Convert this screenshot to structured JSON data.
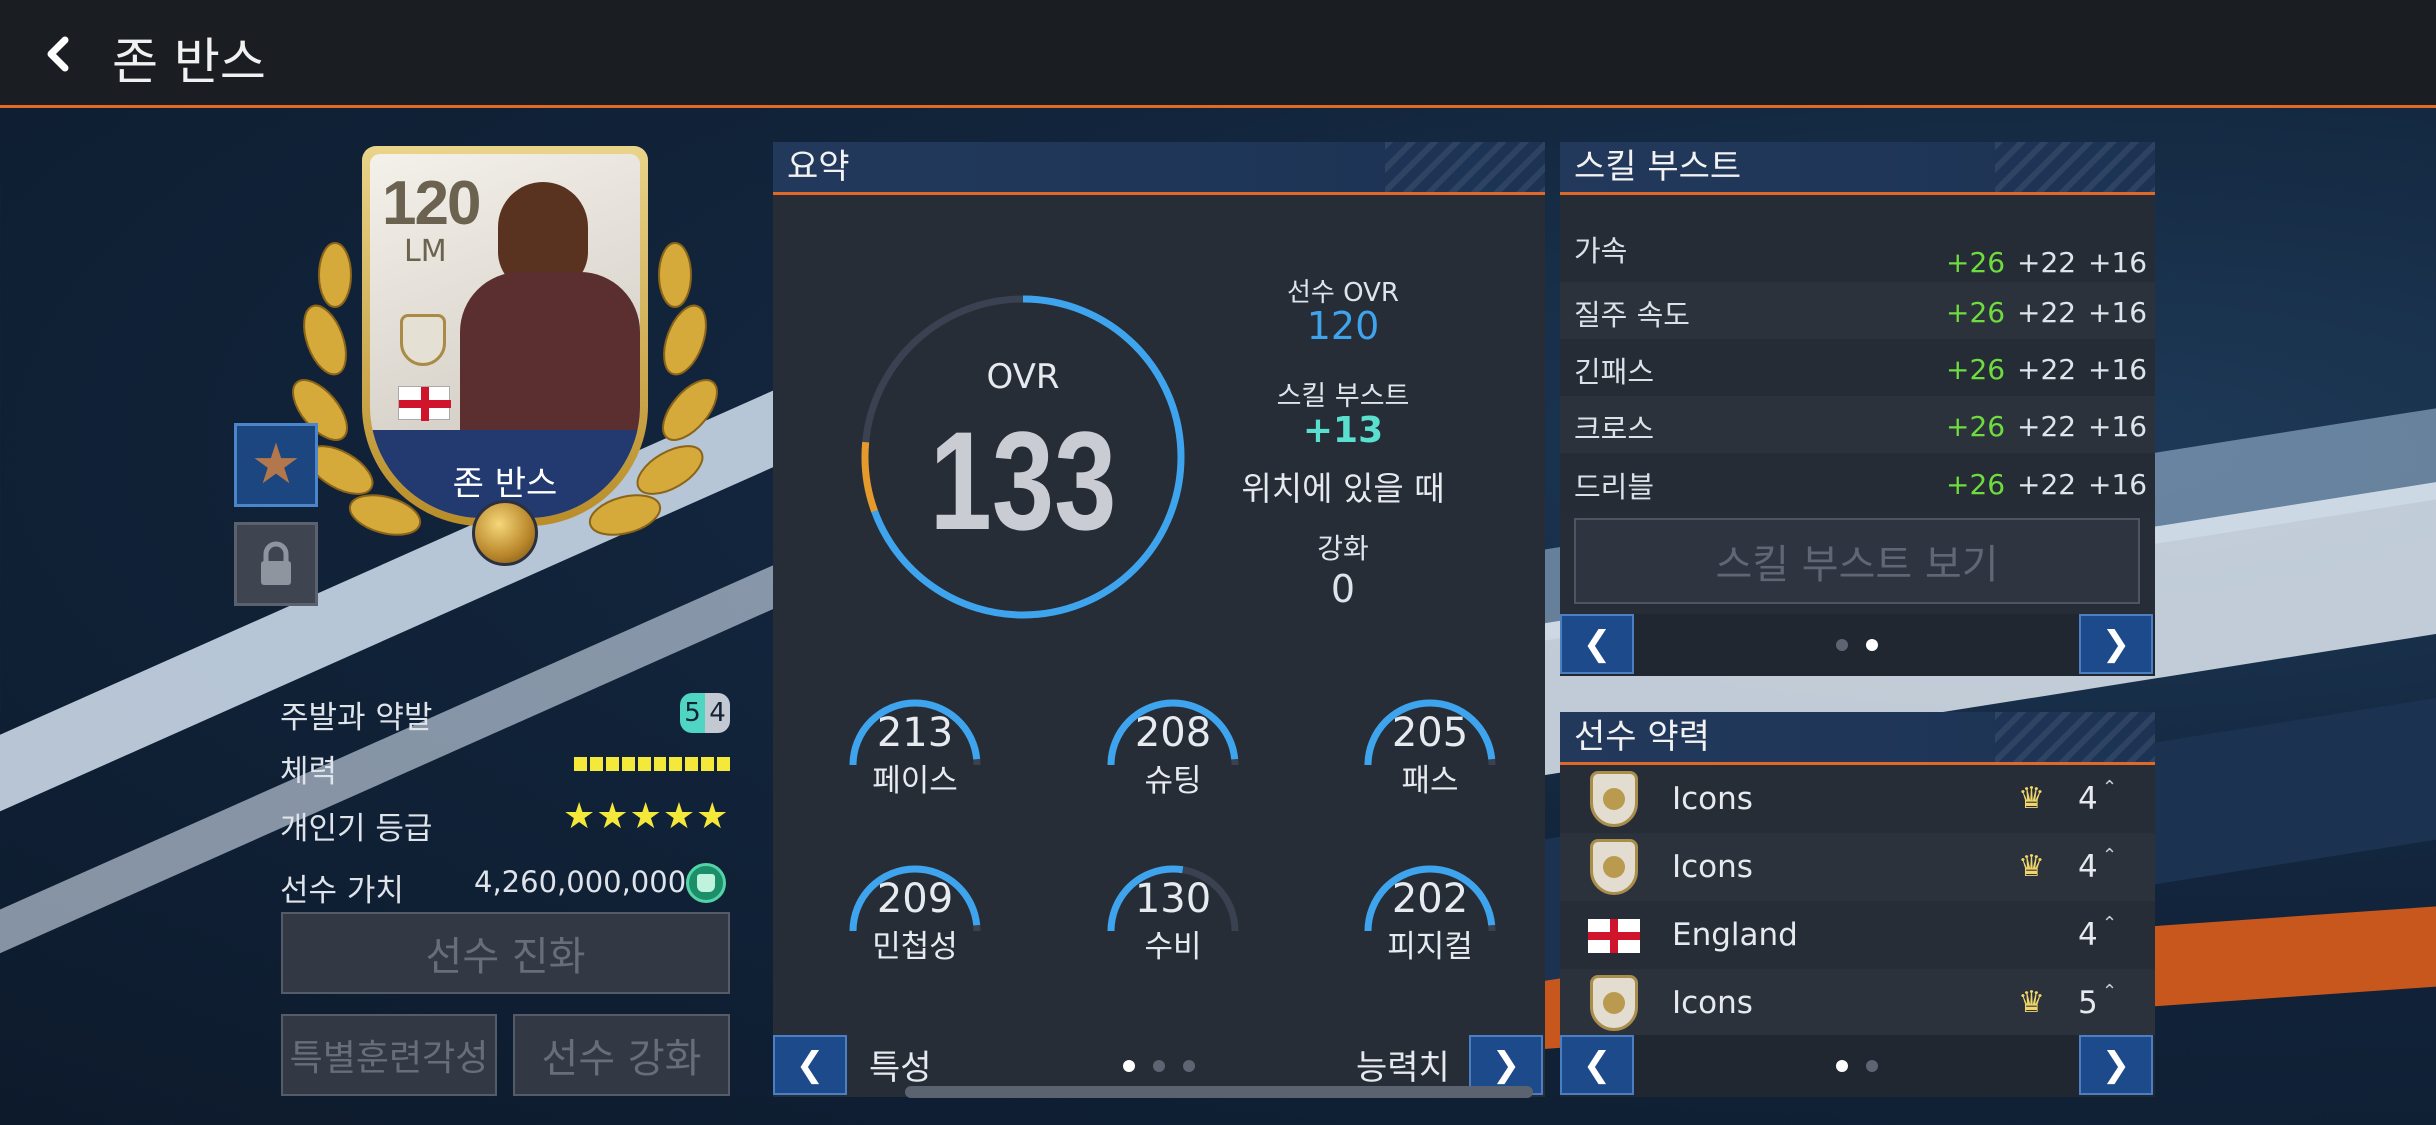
{
  "header": {
    "title": "존 반스"
  },
  "card": {
    "ovr": "120",
    "position": "LM",
    "name": "존 반스"
  },
  "info": {
    "foot_label": "주발과 약발",
    "foot_strong": "5",
    "foot_weak": "4",
    "stamina_label": "체력",
    "stamina_fill": 1.0,
    "popularity_label": "개인기 등급",
    "popularity_stars": "★★★★★",
    "value_label": "선수 가치",
    "value": "4,260,000,000"
  },
  "buttons": {
    "evolve": "선수 진화",
    "special_training": "특별훈련각성",
    "enhance": "선수 강화"
  },
  "summary": {
    "title": "요약",
    "ovr_label": "OVR",
    "ovr_value": "133",
    "player_ovr_label": "선수 OVR",
    "player_ovr_value": "120",
    "skill_boost_label": "스킬 부스트",
    "skill_boost_value": "+13",
    "skill_boost_note": "위치에 있을 때",
    "upgrade_label": "강화",
    "upgrade_value": "0",
    "stats": [
      {
        "label": "페이스",
        "value": "213",
        "level": 0.97
      },
      {
        "label": "슈팅",
        "value": "208",
        "level": 0.97
      },
      {
        "label": "패스",
        "value": "205",
        "level": 0.97
      },
      {
        "label": "민첩성",
        "value": "209",
        "level": 0.97
      },
      {
        "label": "수비",
        "value": "130",
        "level": 0.55
      },
      {
        "label": "피지컬",
        "value": "202",
        "level": 0.97
      }
    ],
    "nav_left": "특성",
    "nav_right": "능력치"
  },
  "skill_boost": {
    "title": "스킬 부스트",
    "levels": [
      "1",
      "2",
      "3"
    ],
    "level_colors": [
      "#f2c12e",
      "#8a93a6",
      "#b8754e"
    ],
    "rows": [
      {
        "name": "가속",
        "v": [
          "+26",
          "+22",
          "+16"
        ]
      },
      {
        "name": "질주 속도",
        "v": [
          "+26",
          "+22",
          "+16"
        ]
      },
      {
        "name": "긴패스",
        "v": [
          "+26",
          "+22",
          "+16"
        ]
      },
      {
        "name": "크로스",
        "v": [
          "+26",
          "+22",
          "+16"
        ]
      },
      {
        "name": "드리블",
        "v": [
          "+26",
          "+22",
          "+16"
        ]
      }
    ],
    "view_button": "스킬 부스트 보기"
  },
  "chemistry": {
    "title": "선수 약력",
    "rows": [
      {
        "name": "Icons",
        "value": "4",
        "icon": "icons-badge-icon"
      },
      {
        "name": "Icons",
        "value": "4",
        "icon": "icons-badge-icon"
      },
      {
        "name": "England",
        "value": "4",
        "icon": "england-flag-icon"
      },
      {
        "name": "Icons",
        "value": "5",
        "icon": "icons-badge-icon"
      }
    ]
  },
  "icons": {
    "back": "chevron-left-icon",
    "prev": "chevron-left-icon",
    "next": "chevron-right-icon"
  }
}
